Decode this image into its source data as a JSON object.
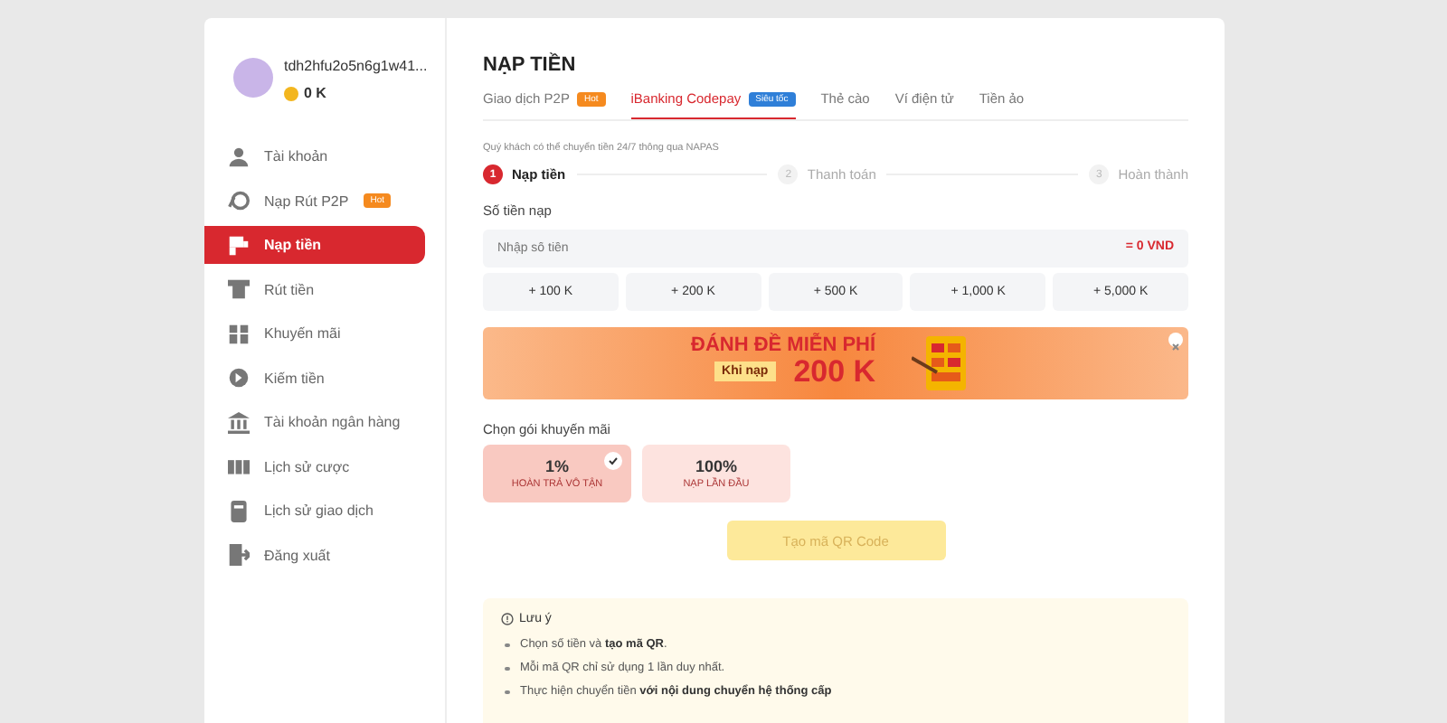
{
  "user": {
    "name": "tdh2hfu2o5n6g1w41...",
    "balance": "0 K"
  },
  "sidebar": {
    "items": [
      {
        "label": "Tài khoản",
        "selected": false
      },
      {
        "label": "Nạp Rút P2P",
        "selected": false,
        "badge": {
          "text": "Hot",
          "color": "#f58a1f"
        }
      },
      {
        "label": "Nạp tiền",
        "selected": true
      },
      {
        "label": "Rút tiền",
        "selected": false
      },
      {
        "label": "Khuyến mãi",
        "selected": false
      },
      {
        "label": "Kiếm tiền",
        "selected": false
      },
      {
        "label": "Tài khoản ngân hàng",
        "selected": false
      },
      {
        "label": "Lịch sử cược",
        "selected": false
      },
      {
        "label": "Lịch sử giao dịch",
        "selected": false
      },
      {
        "label": "Đăng xuất",
        "selected": false
      }
    ]
  },
  "title": "NẠP TIỀN",
  "tabs": [
    {
      "label": "Giao dịch P2P",
      "selected": false,
      "badge": {
        "text": "Hot",
        "color": "#f58a1f"
      }
    },
    {
      "label": "iBanking Codepay",
      "selected": true,
      "badge": {
        "text": "Siêu tốc",
        "color": "#2f7fd8"
      }
    },
    {
      "label": "Thẻ cào",
      "selected": false
    },
    {
      "label": "Ví điện tử",
      "selected": false
    },
    {
      "label": "Tiền ảo",
      "selected": false
    }
  ],
  "notice": "Quý khách có thể chuyển tiền 24/7 thông qua NAPAS",
  "steps": [
    {
      "number": "1",
      "label": "Nạp tiền",
      "selected": true
    },
    {
      "number": "2",
      "label": "Thanh toán",
      "selected": false
    },
    {
      "number": "3",
      "label": "Hoàn thành",
      "selected": false
    }
  ],
  "amount_field": {
    "label": "Số tiền nạp",
    "placeholder": "Nhập số tiền",
    "converted": "= 0 VND"
  },
  "quick_amounts": [
    "+ 100 K",
    "+ 200 K",
    "+ 500 K",
    "+ 1,000 K",
    "+ 5,000 K"
  ],
  "banner": {
    "headline": "ĐÁNH ĐỀ MIỄN PHÍ",
    "condition": "Khi nạp",
    "amount": "200 K"
  },
  "promotions": {
    "label": "Chọn gói khuyến mãi",
    "items": [
      {
        "value": "1%",
        "caption": "HOÀN TRẢ VÔ TẬN",
        "selected": true
      },
      {
        "value": "100%",
        "caption": "NẠP LẦN ĐẦU",
        "selected": false
      }
    ]
  },
  "qr_button": {
    "label": "Tạo mã QR Code",
    "disabled": true
  },
  "note": {
    "title": "Lưu ý",
    "items": [
      "Chọn số tiền và **tạo mã QR**.",
      "Mỗi mã QR chỉ sử dụng 1 lần duy nhất.",
      "Thực hiện chuyển tiền **với nội dung chuyển hệ thống cấp**"
    ]
  }
}
